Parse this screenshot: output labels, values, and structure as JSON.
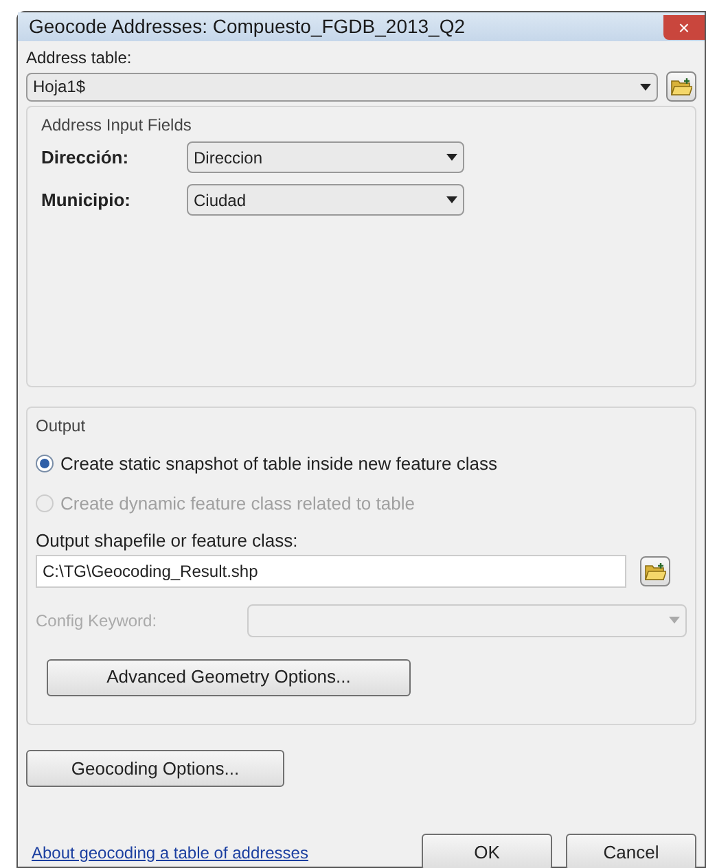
{
  "window": {
    "title": "Geocode Addresses:  Compuesto_FGDB_2013_Q2",
    "close": "×"
  },
  "address_table": {
    "label": "Address table:",
    "value": "Hoja1$"
  },
  "input_fields": {
    "title": "Address Input Fields",
    "rows": [
      {
        "label": "Dirección:",
        "value": "Direccion"
      },
      {
        "label": "Municipio:",
        "value": "Ciudad"
      }
    ]
  },
  "output": {
    "title": "Output",
    "options": [
      {
        "label": "Create static snapshot of table inside new feature class",
        "selected": true,
        "disabled": false
      },
      {
        "label": "Create dynamic feature class related to table",
        "selected": false,
        "disabled": true
      }
    ],
    "path_label": "Output shapefile or feature class:",
    "path_value": "C:\\TG\\Geocoding_Result.shp",
    "config": {
      "label": "Config Keyword:",
      "disabled": true
    },
    "advanced_button": "Advanced Geometry Options..."
  },
  "geocoding_options_button": "Geocoding Options...",
  "help_link": "About geocoding a table of addresses",
  "buttons": [
    "OK",
    "Cancel"
  ]
}
